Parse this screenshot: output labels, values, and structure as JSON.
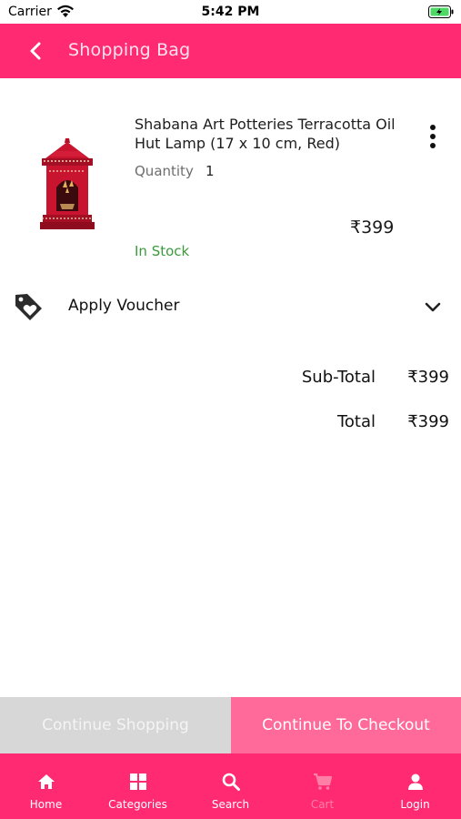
{
  "status_bar": {
    "carrier": "Carrier",
    "time": "5:42 PM"
  },
  "header": {
    "title": "Shopping Bag",
    "back_icon": "chevron-left-icon"
  },
  "cart_item": {
    "name": "Shabana Art Potteries Terracotta Oil Hut Lamp (17 x 10 cm, Red)",
    "quantity_label": "Quantity",
    "quantity": "1",
    "price": "₹399",
    "stock_status": "In Stock",
    "more_icon": "more-vertical-icon"
  },
  "voucher": {
    "label": "Apply Voucher",
    "icon": "tag-heart-icon",
    "chevron": "chevron-down-icon"
  },
  "totals": {
    "subtotal_label": "Sub-Total",
    "subtotal_value": "₹399",
    "total_label": "Total",
    "total_value": "₹399"
  },
  "actions": {
    "continue_shopping": "Continue Shopping",
    "checkout": "Continue To Checkout"
  },
  "tabs": [
    {
      "label": "Home",
      "icon": "home-icon"
    },
    {
      "label": "Categories",
      "icon": "grid-icon"
    },
    {
      "label": "Search",
      "icon": "search-icon"
    },
    {
      "label": "Cart",
      "icon": "cart-icon"
    },
    {
      "label": "Login",
      "icon": "user-icon"
    }
  ],
  "colors": {
    "brand": "#ff2a72",
    "checkout": "#ff6a9a",
    "continue_shopping": "#d7d7d7",
    "in_stock": "#3a9b3a"
  }
}
